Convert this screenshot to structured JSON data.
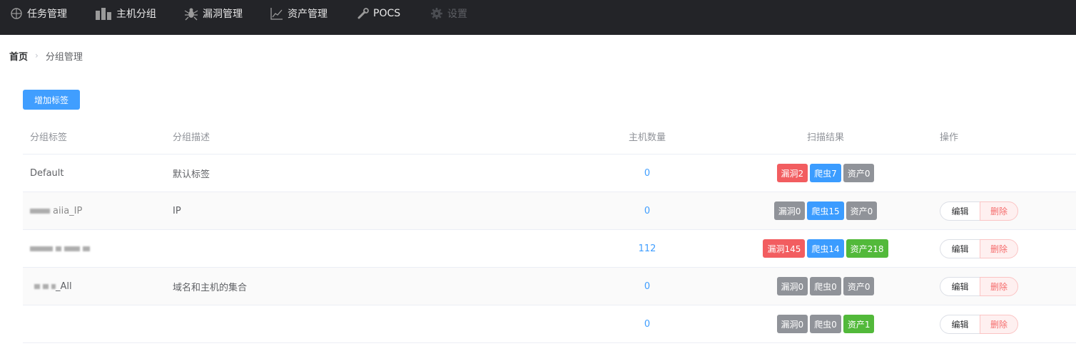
{
  "nav": {
    "items": [
      {
        "label": "任务管理",
        "icon": "crosshair-icon"
      },
      {
        "label": "主机分组",
        "icon": "server-icon"
      },
      {
        "label": "漏洞管理",
        "icon": "bug-icon"
      },
      {
        "label": "资产管理",
        "icon": "chart-line-icon"
      },
      {
        "label": "POCS",
        "icon": "wrench-icon"
      },
      {
        "label": "设置",
        "icon": "gear-icon",
        "disabled": true
      }
    ]
  },
  "breadcrumb": {
    "home": "首页",
    "current": "分组管理"
  },
  "toolbar": {
    "add_label": "增加标签"
  },
  "table": {
    "headers": {
      "tag": "分组标签",
      "desc": "分组描述",
      "count": "主机数量",
      "results": "扫描结果",
      "ops": "操作"
    },
    "rows": [
      {
        "tag": "Default",
        "desc": "默认标签",
        "count": "0",
        "results": [
          {
            "label": "漏洞2",
            "color": "#f25d60"
          },
          {
            "label": "爬虫7",
            "color": "#3b9cff"
          },
          {
            "label": "资产0",
            "color": "#909399"
          }
        ],
        "actions": false
      },
      {
        "tag": "aiia_IP",
        "desc": "IP",
        "count": "0",
        "results": [
          {
            "label": "漏洞0",
            "color": "#909399"
          },
          {
            "label": "爬虫15",
            "color": "#3b9cff"
          },
          {
            "label": "资产0",
            "color": "#909399"
          }
        ],
        "actions": true
      },
      {
        "tag": "",
        "desc": "",
        "count": "112",
        "results": [
          {
            "label": "漏洞145",
            "color": "#f25d60"
          },
          {
            "label": "爬虫14",
            "color": "#3b9cff"
          },
          {
            "label": "资产218",
            "color": "#52b93a"
          }
        ],
        "actions": true
      },
      {
        "tag": "_All",
        "desc": "域名和主机的集合",
        "count": "0",
        "results": [
          {
            "label": "漏洞0",
            "color": "#909399"
          },
          {
            "label": "爬虫0",
            "color": "#909399"
          },
          {
            "label": "资产0",
            "color": "#909399"
          }
        ],
        "actions": true
      },
      {
        "tag": "",
        "desc": "",
        "count": "0",
        "results": [
          {
            "label": "漏洞0",
            "color": "#909399"
          },
          {
            "label": "爬虫0",
            "color": "#909399"
          },
          {
            "label": "资产1",
            "color": "#52b93a"
          }
        ],
        "actions": true
      }
    ],
    "edit_label": "编辑",
    "delete_label": "删除"
  }
}
